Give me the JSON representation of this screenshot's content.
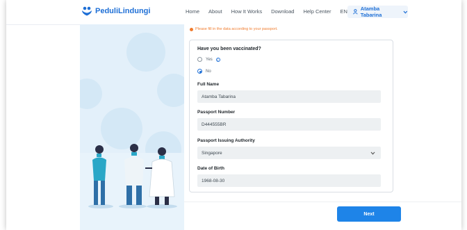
{
  "header": {
    "brand": "PeduliLindungi",
    "nav": [
      "Home",
      "About",
      "How It Works",
      "Download",
      "Help Center",
      "EN"
    ],
    "user": "Atamba Tabarina"
  },
  "form": {
    "notice": "Please fill in the data according to your passport.",
    "question": "Have you been vaccinated?",
    "options": [
      {
        "label": "Yes",
        "selected": false
      },
      {
        "label": "No",
        "selected": true
      }
    ],
    "full_name_label": "Full Name",
    "full_name_value": "Atamba Tabarina",
    "passport_label": "Passport Number",
    "passport_value": "D444555BR",
    "authority_label": "Passport Issuing Authority",
    "authority_value": "Singapore",
    "dob_label": "Date of Birth",
    "dob_value": "1968-08-30",
    "next_label": "Next"
  },
  "colors": {
    "brand": "#1e6fd6",
    "button": "#1e84e8",
    "notice": "#f07c2e",
    "left_panel": "#e3f0fa"
  }
}
